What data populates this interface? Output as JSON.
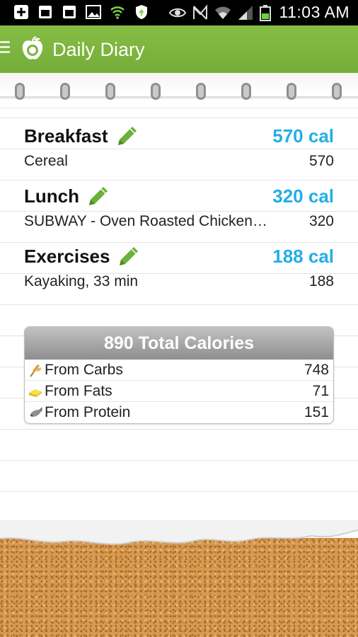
{
  "status_bar": {
    "time": "11:03 AM",
    "left_icons": [
      "add-box-icon",
      "window-icon",
      "window-icon",
      "image-icon",
      "wifi-signal-icon",
      "shield-sync-icon"
    ],
    "right_icons": [
      "eye-icon",
      "no-signal-icon",
      "wifi-icon",
      "cell-signal-icon",
      "battery-icon"
    ]
  },
  "app_bar": {
    "title": "Daily Diary",
    "color": "#7cb342"
  },
  "entries": [
    {
      "name": "Breakfast",
      "calories": "570 cal",
      "item": "Cereal",
      "item_cal": "570"
    },
    {
      "name": "Lunch",
      "calories": "320 cal",
      "item": "SUBWAY - Oven Roasted Chicken…",
      "item_cal": "320"
    },
    {
      "name": "Exercises",
      "calories": "188 cal",
      "item": "Kayaking, 33 min",
      "item_cal": "188"
    }
  ],
  "totals": {
    "title": "890 Total Calories",
    "rows": [
      {
        "label": "From Carbs",
        "value": "748",
        "icon": "wheat-icon"
      },
      {
        "label": "From Fats",
        "value": "71",
        "icon": "butter-icon"
      },
      {
        "label": "From Protein",
        "value": "151",
        "icon": "fish-icon"
      }
    ]
  },
  "colors": {
    "accent_blue": "#23aee6",
    "pencil_green": "#6ab23a"
  }
}
